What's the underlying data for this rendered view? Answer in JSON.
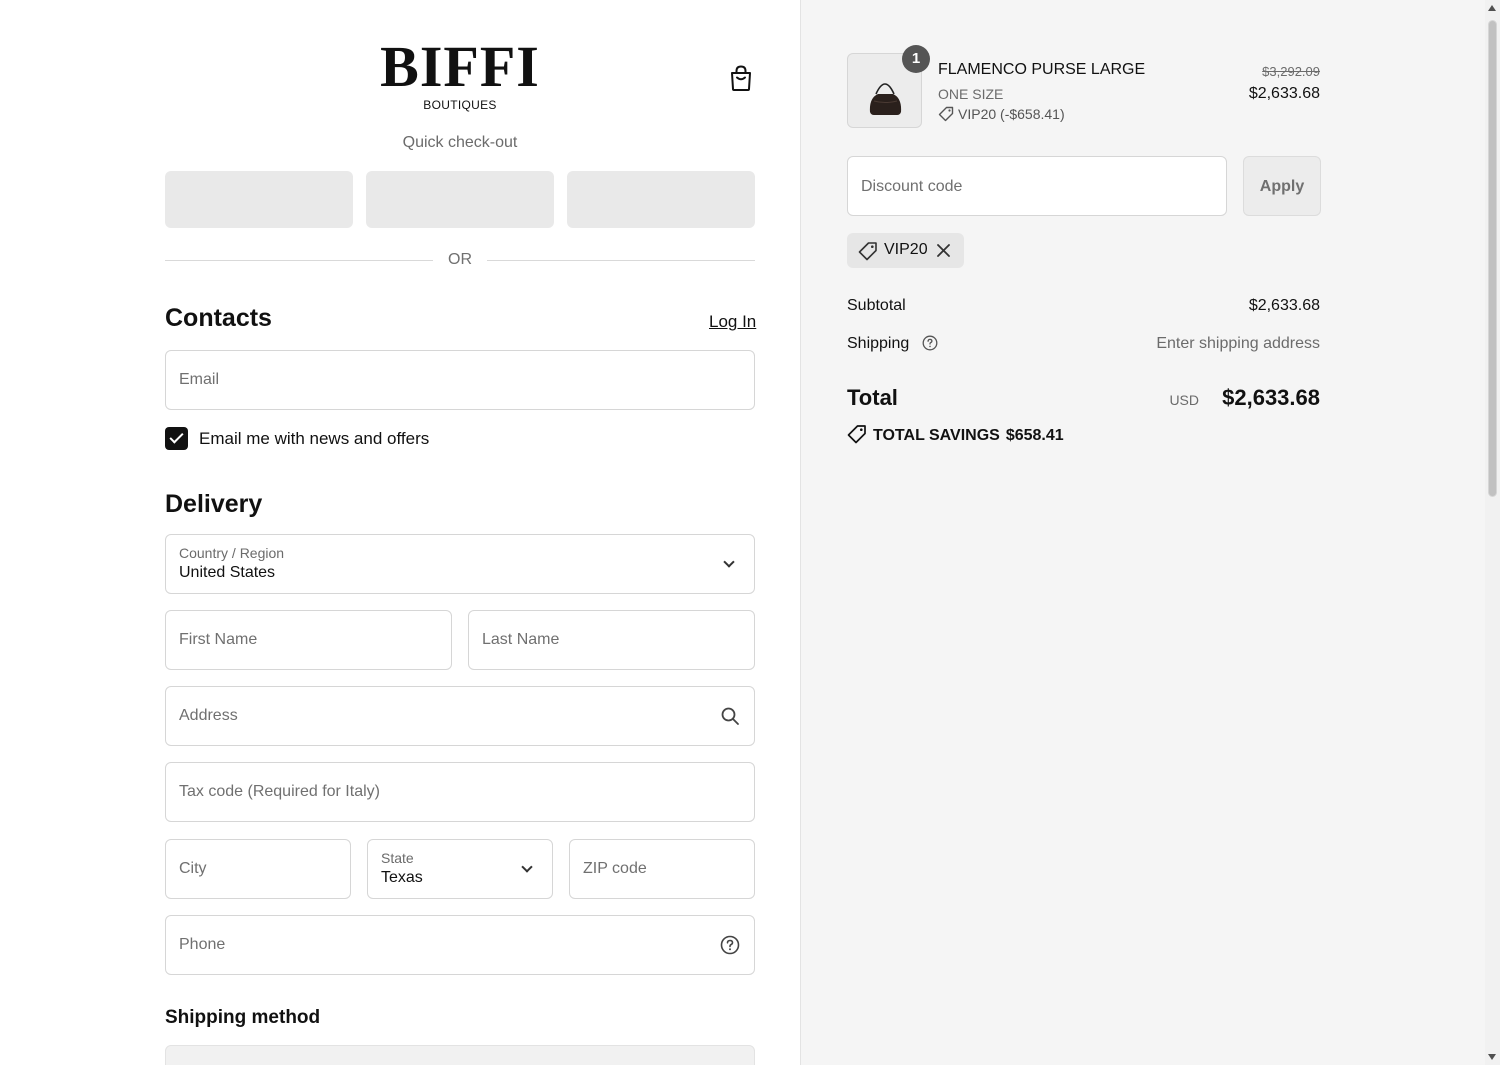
{
  "header": {
    "logo_main": "BIFFI",
    "logo_sub": "BOUTIQUES",
    "quick_checkout": "Quick check-out",
    "or_text": "OR"
  },
  "contacts": {
    "title": "Contacts",
    "login_link": "Log In",
    "email_placeholder": "Email",
    "newsletter_label": "Email me with news and offers",
    "newsletter_checked": true
  },
  "delivery": {
    "title": "Delivery",
    "country_label": "Country / Region",
    "country_value": "United States",
    "first_name_placeholder": "First Name",
    "last_name_placeholder": "Last Name",
    "address_placeholder": "Address",
    "tax_code_placeholder": "Tax code (Required for Italy)",
    "city_placeholder": "City",
    "state_label": "State",
    "state_value": "Texas",
    "zip_placeholder": "ZIP code",
    "phone_placeholder": "Phone"
  },
  "shipping_method": {
    "title": "Shipping method"
  },
  "order": {
    "item": {
      "quantity": "1",
      "name": "FLAMENCO PURSE LARGE",
      "variant": "ONE SIZE",
      "discount": "VIP20 (-$658.41)",
      "original_price": "$3,292.09",
      "price": "$2,633.68"
    },
    "discount_placeholder": "Discount code",
    "apply_label": "Apply",
    "applied_code": "VIP20",
    "subtotal_label": "Subtotal",
    "subtotal_value": "$2,633.68",
    "shipping_label": "Shipping",
    "shipping_value": "Enter shipping address",
    "total_label": "Total",
    "total_currency": "USD",
    "total_value": "$2,633.68",
    "savings_label": "TOTAL SAVINGS",
    "savings_value": "$658.41"
  },
  "colors": {
    "accent": "#111111",
    "summary_bg": "#f5f5f5",
    "muted_text": "#6b6b6b"
  }
}
